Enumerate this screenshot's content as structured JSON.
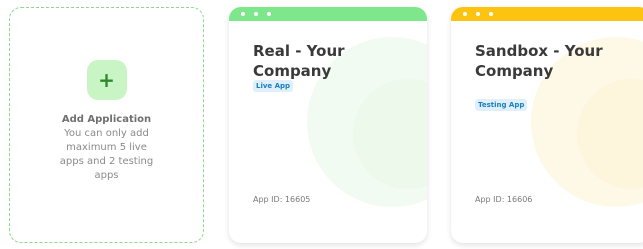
{
  "add_card": {
    "icon": "plus-icon",
    "title": "Add Application",
    "description": "You can only add maximum 5 live apps and 2 testing apps"
  },
  "apps": [
    {
      "title": "Real - Your Company",
      "badge": "Live App",
      "app_id": "App ID: 16605",
      "accent": "#7ee78b"
    },
    {
      "title": "Sandbox - Your Company",
      "badge": "Testing App",
      "app_id": "App ID: 16606",
      "accent": "#fcc410"
    }
  ],
  "colors": {
    "add_border": "#8fd68f",
    "add_button_bg": "#c9f5c5",
    "badge_text": "#1a7fc0",
    "badge_bg": "#dff0fb"
  }
}
